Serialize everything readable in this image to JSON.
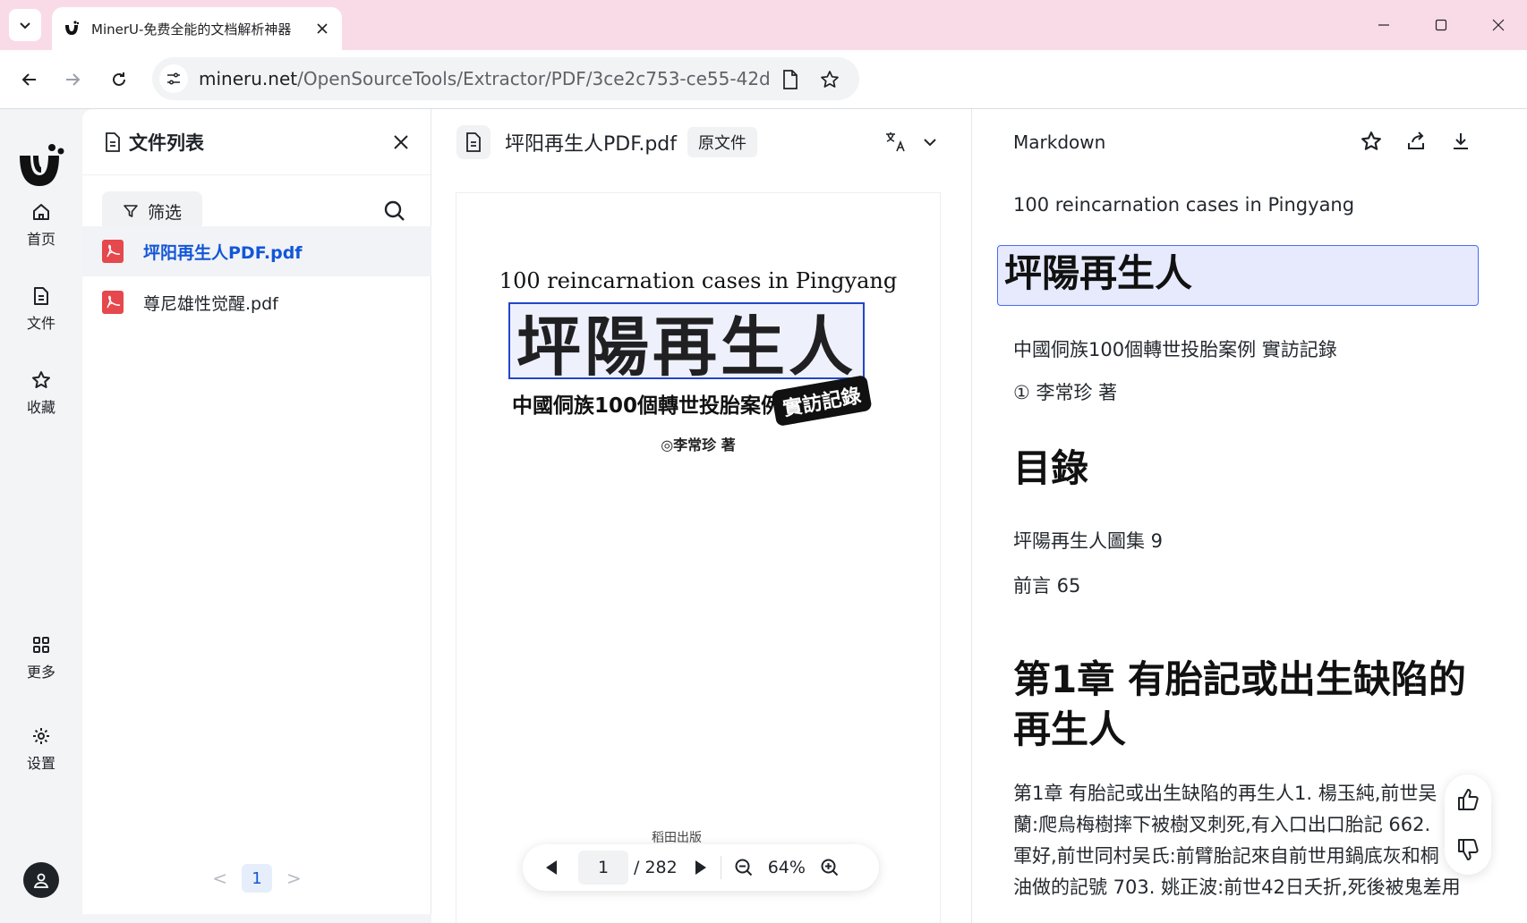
{
  "browser": {
    "tab_title": "MinerU-免费全能的文档解析神器",
    "url_host": "mineru.net",
    "url_path": "/OpenSourceTools/Extractor/PDF/3ce2c753-ce55-42db..."
  },
  "rail": {
    "items": [
      {
        "label": "首页"
      },
      {
        "label": "文件"
      },
      {
        "label": "收藏"
      },
      {
        "label": "更多"
      },
      {
        "label": "设置"
      }
    ]
  },
  "filelist": {
    "title": "文件列表",
    "filter_label": "筛选",
    "files": [
      {
        "name": "坪阳再生人PDF.pdf",
        "active": true
      },
      {
        "name": "尊尼雄性觉醒.pdf",
        "active": false
      }
    ],
    "pager": {
      "prev": "<",
      "current": "1",
      "next": ">"
    }
  },
  "viewer": {
    "file_name": "坪阳再生人PDF.pdf",
    "original_tag": "原文件",
    "page": {
      "subtitle": "100 reincarnation cases in Pingyang",
      "title": "坪陽再生人",
      "subtitle2": "中國侗族100個轉世投胎案例",
      "badge": "實訪記錄",
      "author": "◎李常珍 著",
      "publisher": "稻田出版"
    },
    "controls": {
      "current_page": "1",
      "total": "/ 282",
      "zoom": "64%"
    }
  },
  "markdown": {
    "title": "Markdown",
    "lines": {
      "subtitle": "100 reincarnation cases in Pingyang",
      "h1": "坪陽再生人",
      "desc": "中國侗族100個轉世投胎案例 實訪記錄",
      "author": "① 李常珍 著",
      "toc": "目錄",
      "toc1": "坪陽再生人圖集 9",
      "toc2": "前言 65",
      "chapter": "第1章 有胎記或出生缺陷的再生人",
      "para1": "第1章 有胎記或出生缺陷的再生人1. 楊玉純,前世吴",
      "para2": "蘭:爬烏梅樹摔下被樹叉刺死,有入口出口胎記 662.",
      "para3": "軍好,前世同村吴氏:前臂胎記來自前世用鍋底灰和桐",
      "para4": "油做的記號 703. 姚正波:前世42日夭折,死後被鬼差用"
    }
  },
  "colors": {
    "accent": "#1356d8",
    "highlight": "#e6eafc",
    "tab_bar": "#f9dbe7"
  }
}
